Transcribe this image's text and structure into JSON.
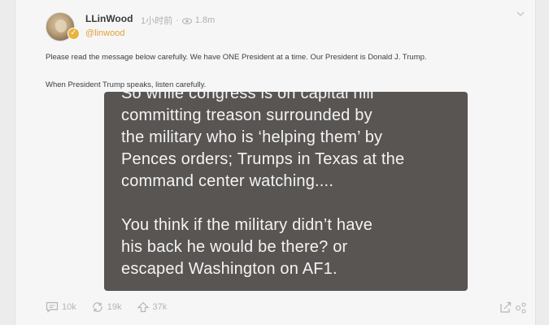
{
  "post": {
    "author_name": "LLinWood",
    "time": "1小时前",
    "separator": "·",
    "views": "1.8m",
    "handle": "@linwood",
    "text_line1": "Please read the message below carefully. We have ONE President at a time. Our President is Donald J. Trump.",
    "text_line2": "When President Trump speaks, listen carefully."
  },
  "quote": {
    "lines_top": [
      "So while congress is on capital hill",
      "committing treason surrounded by",
      "the military who is ‘helping them’ by",
      "Pences orders; Trumps in Texas at the",
      "command center watching...."
    ],
    "lines_bottom": [
      "You think if the military didn’t have",
      "his back he would be there? or",
      "escaped Washington on AF1."
    ]
  },
  "actions": {
    "comments": "10k",
    "reposts": "19k",
    "likes": "37k"
  },
  "colors": {
    "handle": "#e0a23a",
    "quote_bg": "#585553",
    "muted": "#b5b5b5"
  },
  "icons": {
    "comment": "comment-icon",
    "repost": "repost-icon",
    "like": "upvote-icon",
    "share": "share-icon",
    "more": "more-icon",
    "chevron": "chevron-down-icon",
    "eye": "eye-icon",
    "badge": "verified-badge-icon"
  }
}
